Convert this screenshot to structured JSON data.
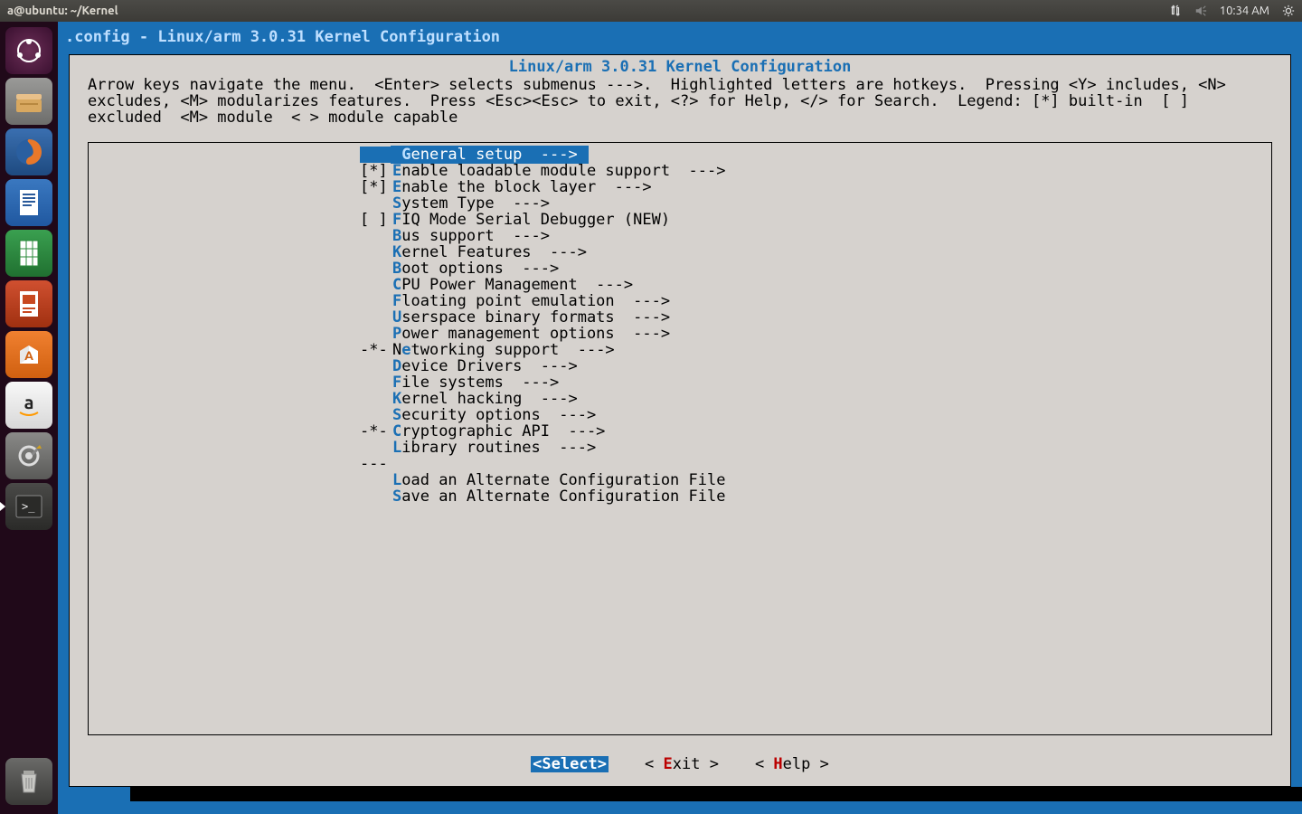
{
  "topbar": {
    "title": "a@ubuntu: ~/Kernel",
    "time": "10:34 AM"
  },
  "terminal": {
    "title": ".config - Linux/arm 3.0.31 Kernel Configuration",
    "panel_header": "Linux/arm 3.0.31 Kernel Configuration",
    "help_text": "Arrow keys navigate the menu.  <Enter> selects submenus --->.  Highlighted letters are hotkeys.  Pressing <Y> includes, <N> excludes, <M> modularizes features.  Press <Esc><Esc> to exit, <?> for Help, </> for Search.  Legend: [*] built-in  [ ] excluded  <M> module  < > module capable"
  },
  "menu": [
    {
      "prefix": "   ",
      "hot": "G",
      "rest": "eneral setup  --->",
      "selected": true
    },
    {
      "prefix": "[*]",
      "hot": "E",
      "rest": "nable loadable module support  --->"
    },
    {
      "prefix": "[*]",
      "hot": "E",
      "rest": "nable the block layer  --->"
    },
    {
      "prefix": "   ",
      "hot": "S",
      "rest": "ystem Type  --->"
    },
    {
      "prefix": "[ ]",
      "hot": "F",
      "rest": "IQ Mode Serial Debugger (NEW)"
    },
    {
      "prefix": "   ",
      "hot": "B",
      "rest": "us support  --->"
    },
    {
      "prefix": "   ",
      "hot": "K",
      "rest": "ernel Features  --->"
    },
    {
      "prefix": "   ",
      "hot": "B",
      "rest": "oot options  --->"
    },
    {
      "prefix": "   ",
      "hot": "C",
      "rest": "PU Power Management  --->"
    },
    {
      "prefix": "   ",
      "hot": "F",
      "rest": "loating point emulation  --->"
    },
    {
      "prefix": "   ",
      "hot": "U",
      "rest": "serspace binary formats  --->"
    },
    {
      "prefix": "   ",
      "hot": "P",
      "rest": "ower management options  --->"
    },
    {
      "prefix": "-*-",
      "hot": "e",
      "pre": "N",
      "rest": "tworking support  --->"
    },
    {
      "prefix": "   ",
      "hot": "D",
      "rest": "evice Drivers  --->"
    },
    {
      "prefix": "   ",
      "hot": "F",
      "rest": "ile systems  --->"
    },
    {
      "prefix": "   ",
      "hot": "K",
      "rest": "ernel hacking  --->"
    },
    {
      "prefix": "   ",
      "hot": "S",
      "rest": "ecurity options  --->"
    },
    {
      "prefix": "-*-",
      "hot": "C",
      "rest": "ryptographic API  --->"
    },
    {
      "prefix": "   ",
      "hot": "L",
      "rest": "ibrary routines  --->"
    },
    {
      "separator": true,
      "text": "---"
    },
    {
      "prefix": "   ",
      "hot": "L",
      "rest": "oad an Alternate Configuration File"
    },
    {
      "prefix": "   ",
      "hot": "S",
      "rest": "ave an Alternate Configuration File"
    }
  ],
  "buttons": {
    "select": "<Select>",
    "exit_pre": "< ",
    "exit_hot": "E",
    "exit_post": "xit >",
    "help_pre": "< ",
    "help_hot": "H",
    "help_post": "elp >"
  }
}
